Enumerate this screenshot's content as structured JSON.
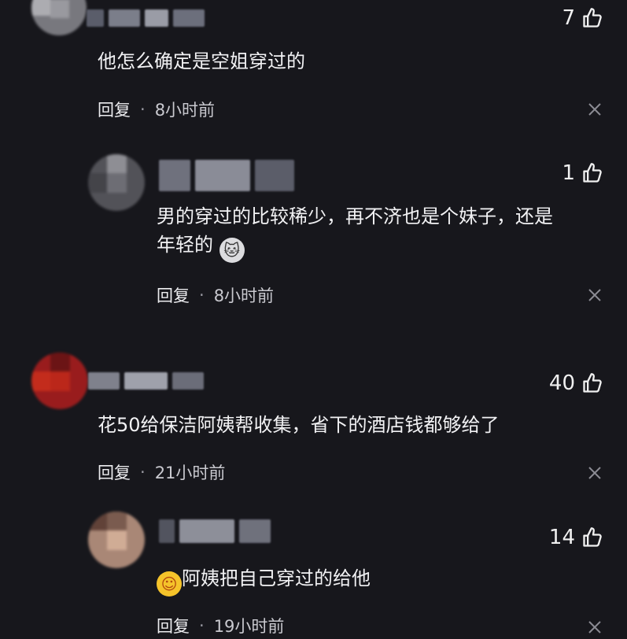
{
  "comments": [
    {
      "likes": "7",
      "text": "他怎么确定是空姐穿过的",
      "reply": "回复",
      "dot": "·",
      "time": "8小时前"
    },
    {
      "likes": "1",
      "text_line1": "男的穿过的比较稀少，再不济也是个妹子，还是",
      "text_line2": "年轻的",
      "emoji": "cat-emoji",
      "reply": "回复",
      "dot": "·",
      "time": "8小时前"
    },
    {
      "likes": "40",
      "text": "花50给保洁阿姨帮收集，省下的酒店钱都够给了",
      "reply": "回复",
      "dot": "·",
      "time": "21小时前"
    },
    {
      "likes": "14",
      "emoji": "blushing-face-emoji",
      "text": "阿姨把自己穿过的给他",
      "reply": "回复",
      "dot": "·",
      "time": "19小时前"
    }
  ],
  "colors": {
    "background": "#17171c",
    "text": "#f2f2f4",
    "muted": "#8c8c94"
  }
}
